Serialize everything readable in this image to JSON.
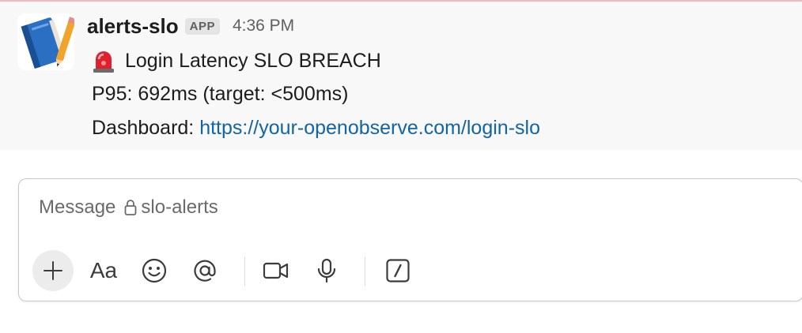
{
  "message": {
    "sender": "alerts-slo",
    "badge": "APP",
    "time": "4:36 PM",
    "title": "Login Latency SLO BREACH",
    "metric": "P95: 692ms (target: <500ms)",
    "dashboard_label": "Dashboard: ",
    "dashboard_url": "https://your-openobserve.com/login-slo"
  },
  "composer": {
    "placeholder": "Message",
    "channel": "slo-alerts",
    "aa_label": "Aa"
  },
  "colors": {
    "link": "#1264a3",
    "message_bg": "#f8f8f8",
    "top_rule": "#f2b6bd"
  },
  "icons": [
    "book-pencil-avatar-icon",
    "rotating-light-icon",
    "lock-icon",
    "plus-icon",
    "smile-icon",
    "at-icon",
    "video-icon",
    "microphone-icon",
    "slash-command-icon"
  ]
}
